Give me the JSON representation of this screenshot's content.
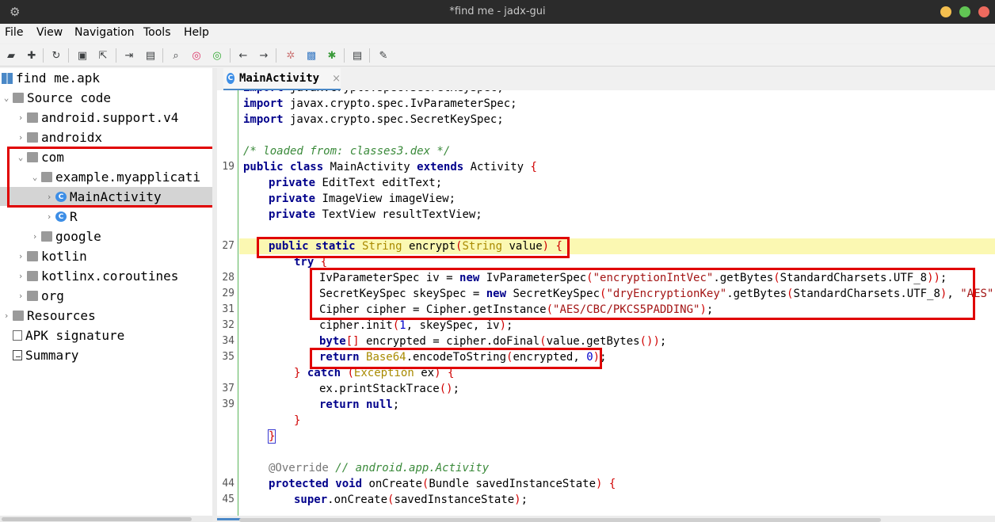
{
  "window": {
    "title": "*find me - jadx-gui"
  },
  "menu": [
    "File",
    "View",
    "Navigation",
    "Tools",
    "Help"
  ],
  "toolbar_icons": [
    "open-file-icon",
    "add-file-icon",
    "refresh-icon",
    "save-all-icon",
    "export-icon",
    "sync-tree-icon",
    "flatten-packages-icon",
    "search-icon",
    "find-class-icon",
    "find-usage-icon",
    "back-icon",
    "forward-icon",
    "quark-icon",
    "deobfuscation-icon",
    "debug-icon",
    "log-viewer-icon",
    "preferences-icon"
  ],
  "tree": [
    {
      "label": "find me.apk",
      "icon": "apk-icon"
    },
    {
      "label": "Source code",
      "icon": "source-icon"
    },
    {
      "label": "android.support.v4",
      "icon": "package-icon"
    },
    {
      "label": "androidx",
      "icon": "package-icon"
    },
    {
      "label": "com",
      "icon": "package-icon"
    },
    {
      "label": "example.myapplicati",
      "icon": "package-icon"
    },
    {
      "label": "MainActivity",
      "icon": "class-icon"
    },
    {
      "label": "R",
      "icon": "class-icon"
    },
    {
      "label": "google",
      "icon": "package-icon"
    },
    {
      "label": "kotlin",
      "icon": "package-icon"
    },
    {
      "label": "kotlinx.coroutines",
      "icon": "package-icon"
    },
    {
      "label": "org",
      "icon": "package-icon"
    },
    {
      "label": "Resources",
      "icon": "resources-icon"
    },
    {
      "label": "APK signature",
      "icon": "signature-icon"
    },
    {
      "label": "Summary",
      "icon": "summary-icon"
    }
  ],
  "editor": {
    "tab_label": "MainActivity",
    "tab_close": "×",
    "line_numbers": [
      "19",
      "27",
      "28",
      "29",
      "31",
      "32",
      "34",
      "35",
      "37",
      "39",
      "44",
      "45"
    ]
  },
  "colors": {
    "accent": "#4a88c7",
    "highlight_box": "#e00000",
    "current_line": "#fbf8b2",
    "titlebar": "#2b2b2b"
  }
}
